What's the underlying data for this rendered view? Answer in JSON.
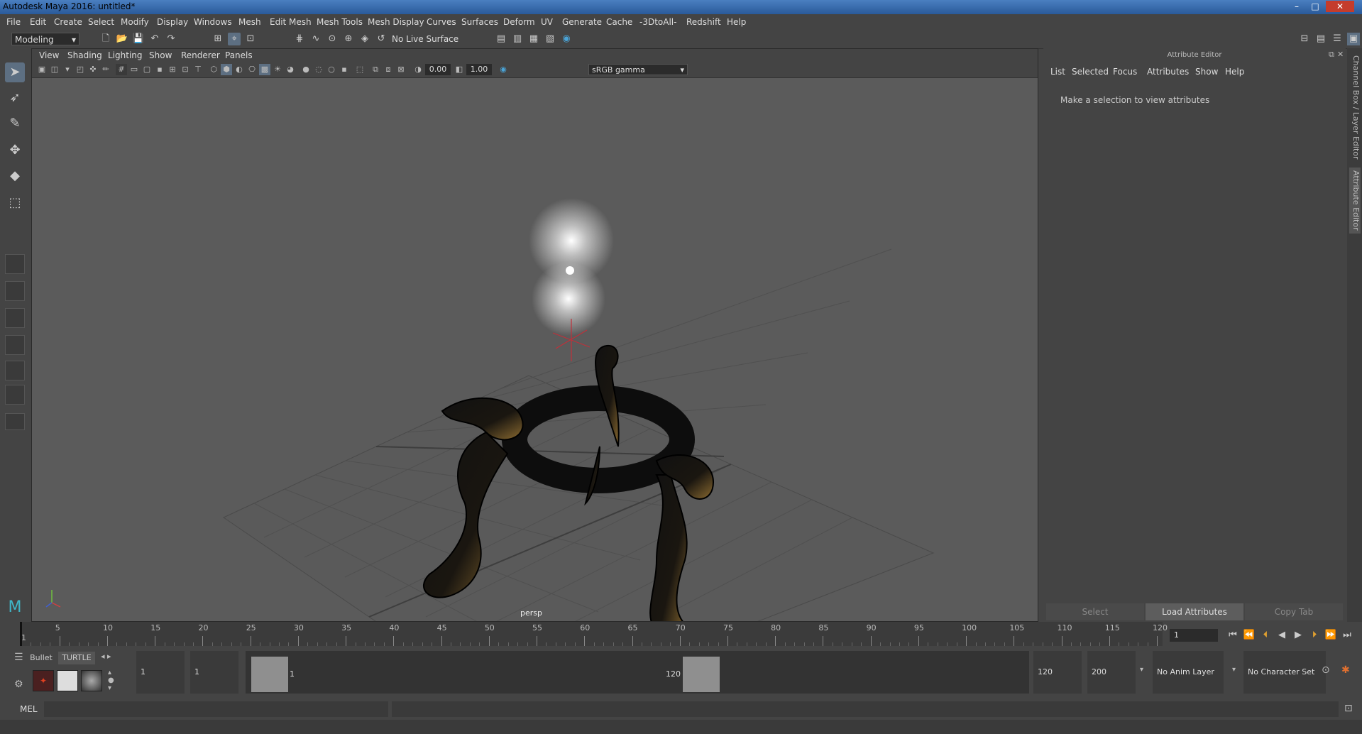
{
  "window": {
    "title": "Autodesk Maya 2016: untitled*"
  },
  "menubar": [
    "File",
    "Edit",
    "Create",
    "Select",
    "Modify",
    "Display",
    "Windows",
    "Mesh",
    "Edit Mesh",
    "Mesh Tools",
    "Mesh Display",
    "Curves",
    "Surfaces",
    "Deform",
    "UV",
    "Generate",
    "Cache",
    "-3DtoAll-",
    "Redshift",
    "Help"
  ],
  "statusline": {
    "mode": "Modeling",
    "live_surface": "No Live Surface"
  },
  "viewport": {
    "menus": [
      "View",
      "Shading",
      "Lighting",
      "Show",
      "Renderer",
      "Panels"
    ],
    "exposure": "0.00",
    "gamma": "1.00",
    "colorspace": "sRGB gamma",
    "camera_label": "persp"
  },
  "attribute_editor": {
    "title": "Attribute Editor",
    "menus": [
      "List",
      "Selected",
      "Focus",
      "Attributes",
      "Show",
      "Help"
    ],
    "message": "Make a selection to view attributes",
    "buttons": {
      "select": "Select",
      "load": "Load Attributes",
      "copy": "Copy Tab"
    }
  },
  "side_tabs": {
    "channel_box": "Channel Box / Layer Editor",
    "attr_editor": "Attribute Editor"
  },
  "time_slider": {
    "ticks": [
      "1",
      "5",
      "10",
      "15",
      "20",
      "25",
      "30",
      "35",
      "40",
      "45",
      "50",
      "55",
      "60",
      "65",
      "70",
      "75",
      "80",
      "85",
      "90",
      "95",
      "100",
      "105",
      "110",
      "115",
      "120"
    ],
    "current_frame": "1"
  },
  "range_slider": {
    "start": "1",
    "anim_start": "1",
    "range_start_label": "1",
    "range_end_label": "120",
    "end": "120",
    "anim_end": "200",
    "anim_layer": "No Anim Layer",
    "character_set": "No Character Set"
  },
  "shelf": {
    "tabs": [
      "Bullet",
      "TURTLE"
    ]
  },
  "command_line": {
    "label": "MEL"
  }
}
